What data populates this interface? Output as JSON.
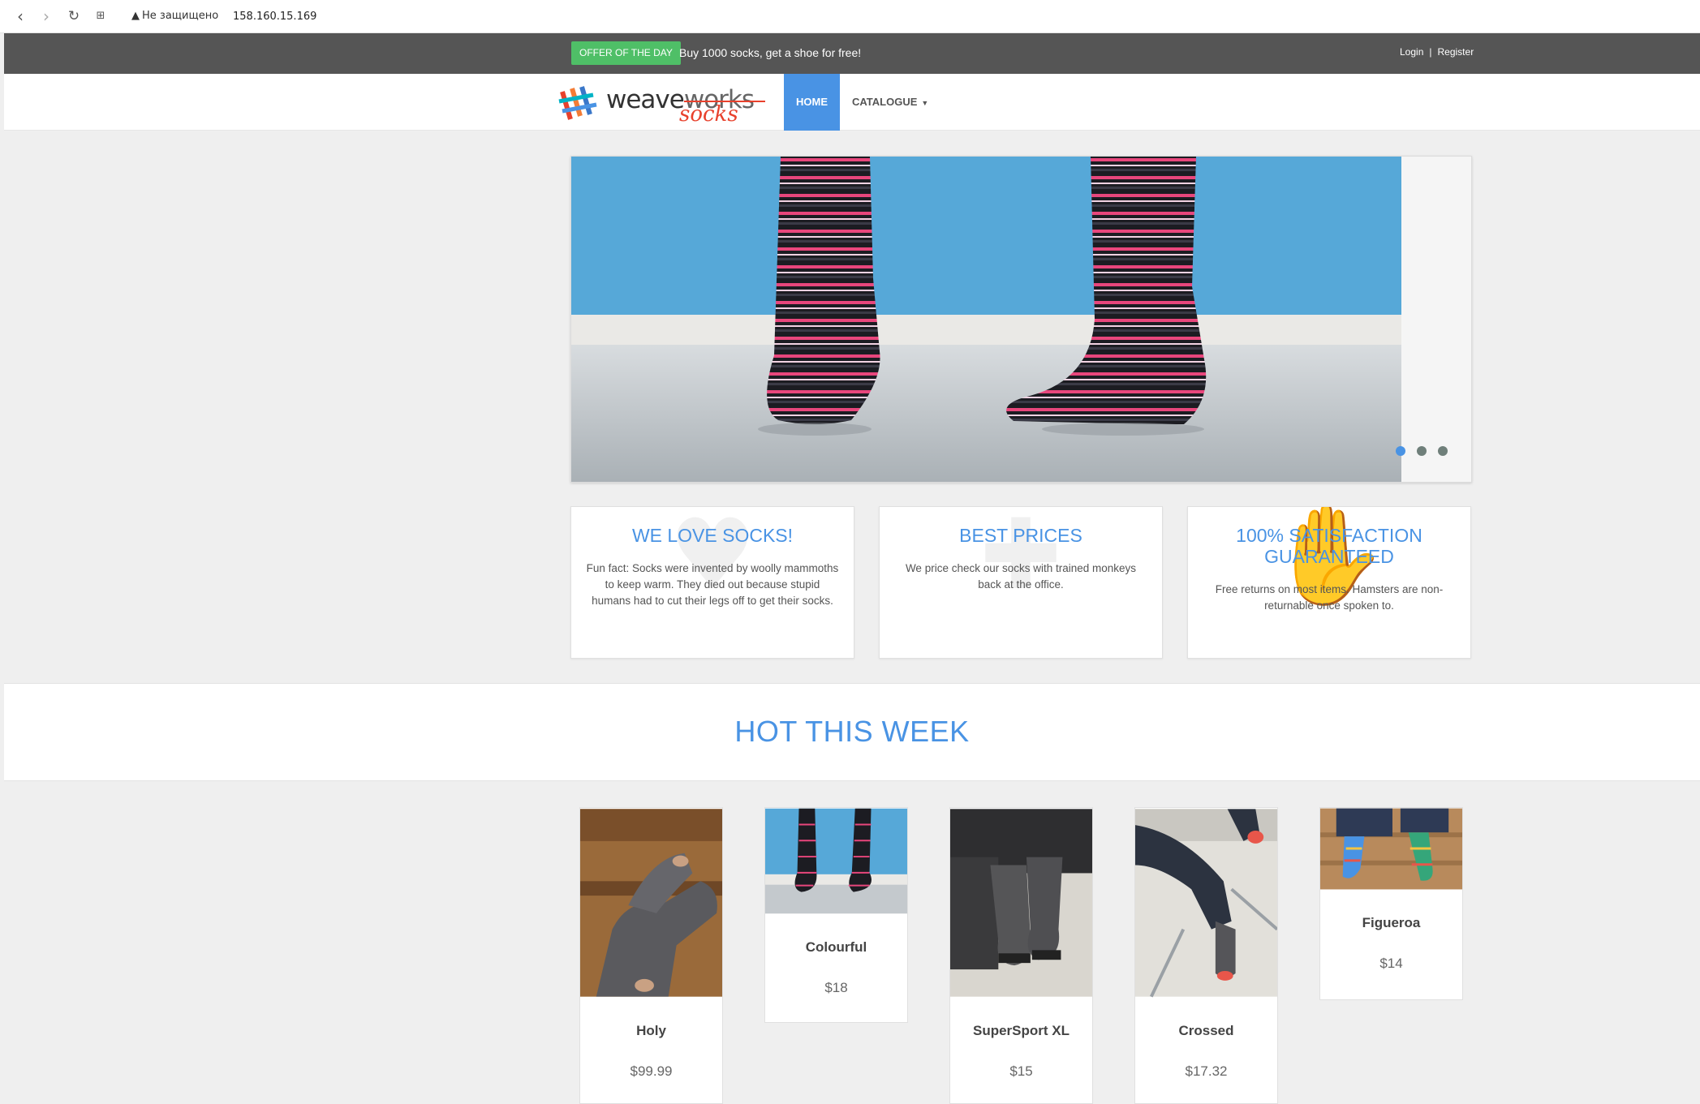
{
  "browser": {
    "warning": "Не защищено",
    "url": "158.160.15.169"
  },
  "topbar": {
    "offer_badge": "OFFER OF THE DAY",
    "offer_text": "Buy 1000 socks, get a shoe for free!",
    "login": "Login",
    "separator": "|",
    "register": "Register"
  },
  "navbar": {
    "logo_weave": "weave",
    "logo_works": "works",
    "logo_socks": "socks",
    "home": "HOME",
    "catalogue": "CATALOGUE"
  },
  "carousel": {
    "slide_count": 3,
    "active_slide": 1
  },
  "features": [
    {
      "title": "WE LOVE SOCKS!",
      "text": "Fun fact: Socks were invented by woolly mammoths to keep warm. They died out because stupid humans had to cut their legs off to get their socks.",
      "icon": "heart-icon"
    },
    {
      "title": "BEST PRICES",
      "text": "We price check our socks with trained monkeys back at the office.",
      "icon": "tag-icon"
    },
    {
      "title": "100% SATISFACTION GUARANTEED",
      "text": "Free returns on most items. Hamsters are non-returnable once spoken to.",
      "icon": "thumbs-up-icon"
    }
  ],
  "hot": {
    "title": "HOT THIS WEEK"
  },
  "products": [
    {
      "name": "Holy",
      "price": "$99.99"
    },
    {
      "name": "Colourful",
      "price": "$18"
    },
    {
      "name": "SuperSport XL",
      "price": "$15"
    },
    {
      "name": "Crossed",
      "price": "$17.32"
    },
    {
      "name": "Figueroa",
      "price": "$14"
    }
  ],
  "colors": {
    "accent": "#4993e4",
    "topbar": "#555555",
    "offer_badge": "#4fbf67",
    "logo_red": "#e8412c"
  }
}
